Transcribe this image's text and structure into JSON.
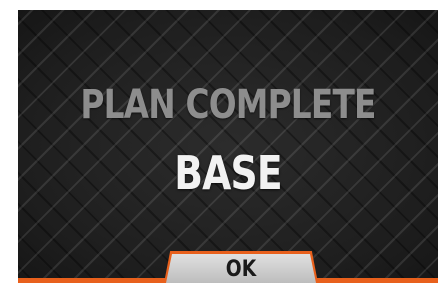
{
  "dialog": {
    "title": "PLAN COMPLETE",
    "subtitle": "BASE",
    "ok_label": "OK"
  },
  "colors": {
    "accent": "#e8601c",
    "title": "#8d8d8d",
    "subtitle": "#f2f2f2",
    "button_bg": "#d0d0d0",
    "background": "#222222"
  },
  "icons": {
    "background_pattern": "diamond-plate-pattern"
  }
}
